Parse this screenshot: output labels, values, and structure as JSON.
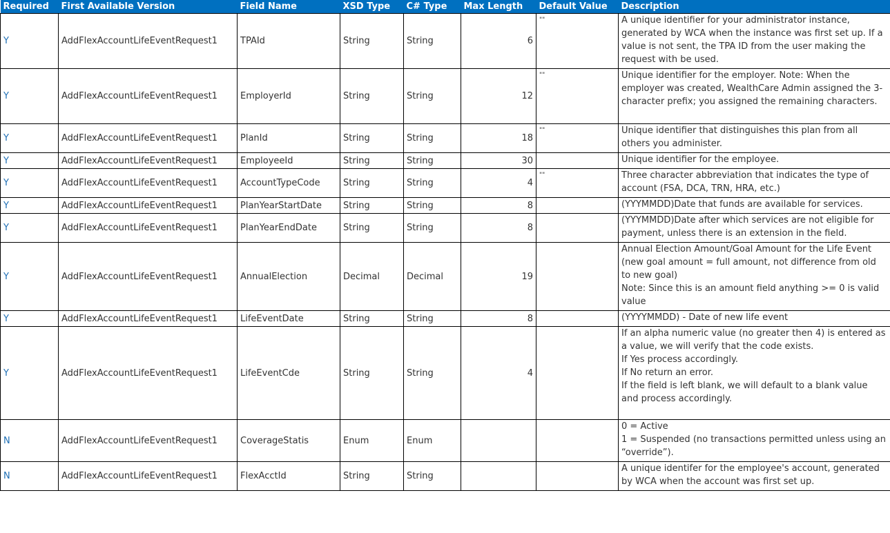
{
  "headers": [
    "Required",
    "First Available Version",
    "Field Name",
    "XSD Type",
    "C# Type",
    "Max Length",
    "Default Value",
    "Description"
  ],
  "rows": [
    {
      "required": "Y",
      "version": "AddFlexAccountLifeEventRequest1",
      "field": "TPAId",
      "xsd": "String",
      "cs": "String",
      "max": "6",
      "default": "\"\"",
      "description": [
        "A unique identifier for your administrator instance, generated by WCA when the instance was first set up. If a value is not sent, the TPA ID from the user making the request with be used."
      ]
    },
    {
      "required": "Y",
      "version": "AddFlexAccountLifeEventRequest1",
      "field": "EmployerId",
      "xsd": "String",
      "cs": "String",
      "max": "12",
      "default": "\"\"",
      "description": [
        "Unique identifier for the employer. Note: When the employer was created, WealthCare Admin assigned the 3-character prefix; you assigned the remaining characters."
      ]
    },
    {
      "required": "Y",
      "version": "AddFlexAccountLifeEventRequest1",
      "field": "PlanId",
      "xsd": "String",
      "cs": "String",
      "max": "18",
      "default": "\"\"",
      "description": [
        "Unique identifier that distinguishes this plan from all others you administer."
      ]
    },
    {
      "required": "Y",
      "version": "AddFlexAccountLifeEventRequest1",
      "field": "EmployeeId",
      "xsd": "String",
      "cs": "String",
      "max": "30",
      "default": "",
      "description": [
        "Unique identifier for the employee."
      ]
    },
    {
      "required": "Y",
      "version": "AddFlexAccountLifeEventRequest1",
      "field": "AccountTypeCode",
      "xsd": "String",
      "cs": "String",
      "max": "4",
      "default": "\"\"",
      "description": [
        "Three character abbreviation that indicates the type of account (FSA, DCA, TRN, HRA, etc.)"
      ]
    },
    {
      "required": "Y",
      "version": "AddFlexAccountLifeEventRequest1",
      "field": "PlanYearStartDate",
      "xsd": "String",
      "cs": "String",
      "max": "8",
      "default": "",
      "description": [
        "(YYYMMDD)Date that funds are available for services."
      ]
    },
    {
      "required": "Y",
      "version": "AddFlexAccountLifeEventRequest1",
      "field": "PlanYearEndDate",
      "xsd": "String",
      "cs": "String",
      "max": "8",
      "default": "",
      "description": [
        "(YYYMMDD)Date after which services are not eligible for payment, unless there is an extension in the field."
      ]
    },
    {
      "required": "Y",
      "version": "AddFlexAccountLifeEventRequest1",
      "field": "AnnualElection",
      "xsd": "Decimal",
      "cs": "Decimal",
      "max": "19",
      "default": "",
      "description": [
        "Annual Election Amount/Goal Amount for the Life Event (new goal amount = full amount, not difference from old to new goal)",
        "Note: Since this is an amount field anything >= 0 is valid value"
      ]
    },
    {
      "required": "Y",
      "version": "AddFlexAccountLifeEventRequest1",
      "field": "LifeEventDate",
      "xsd": "String",
      "cs": "String",
      "max": "8",
      "default": "",
      "description": [
        "(YYYYMMDD) - Date of new life event"
      ]
    },
    {
      "required": "Y",
      "version": "AddFlexAccountLifeEventRequest1",
      "field": "LifeEventCde",
      "xsd": "String",
      "cs": "String",
      "max": "4",
      "default": "",
      "description": [
        "If an alpha numeric value (no greater then 4) is entered as a value, we will verify that the code exists.",
        "If Yes process accordingly.",
        "If No return an error.",
        "If the field is left blank, we will default to a blank value and process accordingly."
      ]
    },
    {
      "required": "N",
      "version": "AddFlexAccountLifeEventRequest1",
      "field": "CoverageStatis",
      "xsd": "Enum",
      "cs": "Enum",
      "max": "",
      "default": "",
      "description": [
        "0 = Active",
        "1 = Suspended (no transactions permitted unless using an “override”)."
      ]
    },
    {
      "required": "N",
      "version": "AddFlexAccountLifeEventRequest1",
      "field": "FlexAcctId",
      "xsd": "String",
      "cs": "String",
      "max": "",
      "default": "",
      "description": [
        "A unique identifer for the employee's account, generated by WCA when the account was first set up."
      ]
    }
  ]
}
